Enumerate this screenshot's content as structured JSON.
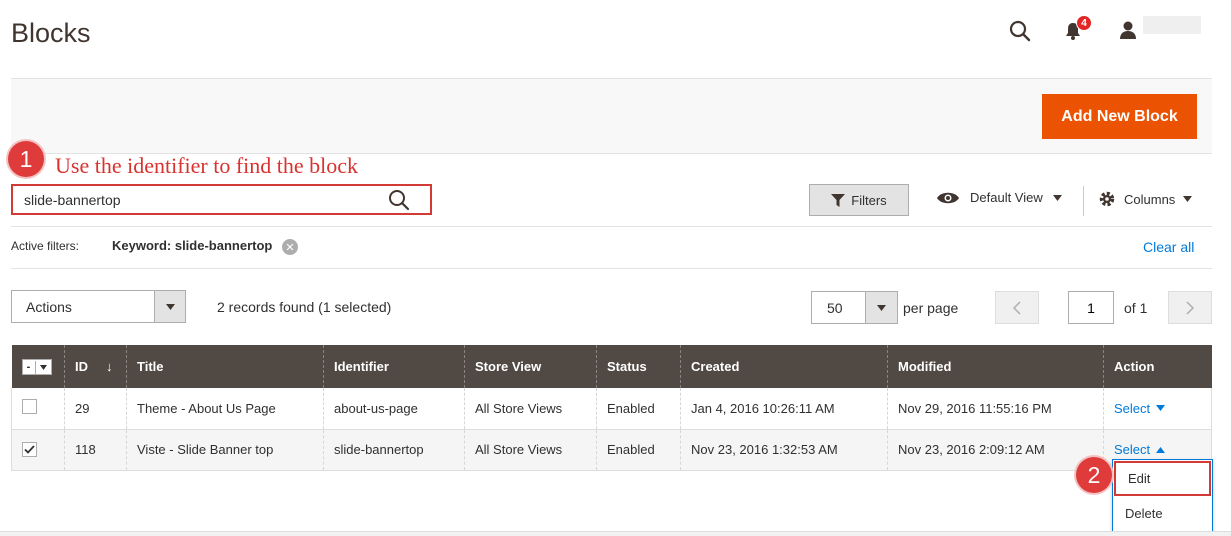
{
  "page": {
    "title": "Blocks"
  },
  "header": {
    "notifications_count": "4"
  },
  "actions": {
    "add_new_label": "Add New Block"
  },
  "annotations": {
    "callout1_num": "1",
    "callout1_text": "Use the identifier to find the  block",
    "callout2_num": "2"
  },
  "search": {
    "value": "slide-bannertop"
  },
  "toolbar": {
    "filters_label": "Filters",
    "view_label": "Default View",
    "columns_label": "Columns"
  },
  "active_filters": {
    "label": "Active filters:",
    "value": "Keyword: slide-bannertop",
    "clear_all": "Clear all"
  },
  "grid_controls": {
    "actions_label": "Actions",
    "records_found": "2 records found (1 selected)",
    "page_size": "50",
    "per_page_label": "per page",
    "current_page": "1",
    "of_pages": "of 1"
  },
  "table": {
    "headers": [
      "ID",
      "Title",
      "Identifier",
      "Store View",
      "Status",
      "Created",
      "Modified",
      "Action"
    ],
    "rows": [
      {
        "checked": false,
        "id": "29",
        "title": "Theme - About Us Page",
        "identifier": "about-us-page",
        "store_view": "All Store Views",
        "status": "Enabled",
        "created": "Jan 4, 2016 10:26:11 AM",
        "modified": "Nov 29, 2016 11:55:16 PM",
        "action": "Select"
      },
      {
        "checked": true,
        "id": "118",
        "title": "Viste - Slide Banner top",
        "identifier": "slide-bannertop",
        "store_view": "All Store Views",
        "status": "Enabled",
        "created": "Nov 23, 2016 1:32:53 AM",
        "modified": "Nov 23, 2016 2:09:12 AM",
        "action": "Select"
      }
    ]
  },
  "row_action_menu": {
    "edit": "Edit",
    "delete": "Delete"
  },
  "colors": {
    "accent": "#eb5202",
    "header_bg": "#514943",
    "link": "#007bdb",
    "annotation": "#d8332f"
  }
}
